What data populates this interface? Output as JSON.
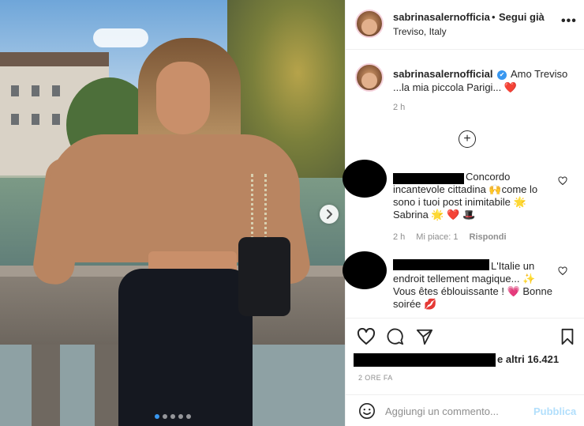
{
  "post": {
    "username": "sabrinasalernofficia",
    "dot": "•",
    "follow_label": "Segui già",
    "location": "Treviso, Italy"
  },
  "caption": {
    "username": "sabrinasalernofficial",
    "verified_icon": "✔",
    "text": "Amo Treviso ...la mia piccola Parigi... ❤️",
    "time": "2 h"
  },
  "comments": [
    {
      "text": "Concordo incantevole cittadina 🙌come lo sono i tuoi post inimitabile 🌟 Sabrina 🌟 ❤️ 🎩",
      "time": "2 h",
      "likes": "Mi piace: 1",
      "reply": "Rispondi"
    },
    {
      "text": "L'Italie un endroit tellement magique... ✨ Vous êtes éblouissante ! 💗 Bonne soirée 💋"
    }
  ],
  "likes_text": "e altri 16.421",
  "post_age": "2 ORE FA",
  "comment_box": {
    "placeholder": "Aggiungi un commento...",
    "post_label": "Pubblica"
  },
  "icons": {
    "more": "more-options-icon",
    "heart": "heart-icon",
    "comment": "comment-icon",
    "share": "share-icon",
    "bookmark": "bookmark-icon",
    "emoji": "emoji-icon",
    "plus": "load-more-icon",
    "next": "chevron-right-icon"
  },
  "colors": {
    "accent_blue": "#3897f0",
    "post_button_disabled": "#b2dffc",
    "muted_text": "#8e8e8e",
    "border": "#efefef"
  },
  "carousel": {
    "slide_count": 5,
    "active_index": 0
  }
}
